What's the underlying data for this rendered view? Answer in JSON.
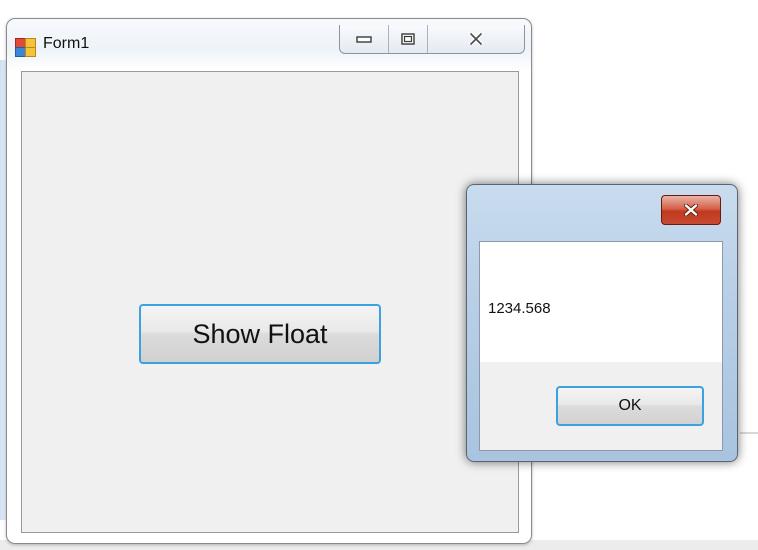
{
  "form": {
    "title": "Form1",
    "icon": "windows-forms-app-icon",
    "caption_buttons": [
      "minimize-icon",
      "maximize-icon",
      "close-icon"
    ],
    "show_float_button": "Show Float"
  },
  "message_box": {
    "close_icon": "close-icon",
    "message": "1234.568",
    "ok_button": "OK"
  },
  "colors": {
    "focus_border": "#3ca1e0",
    "close_button_red": "#c0391f",
    "client_area": "#f0f0f0"
  }
}
